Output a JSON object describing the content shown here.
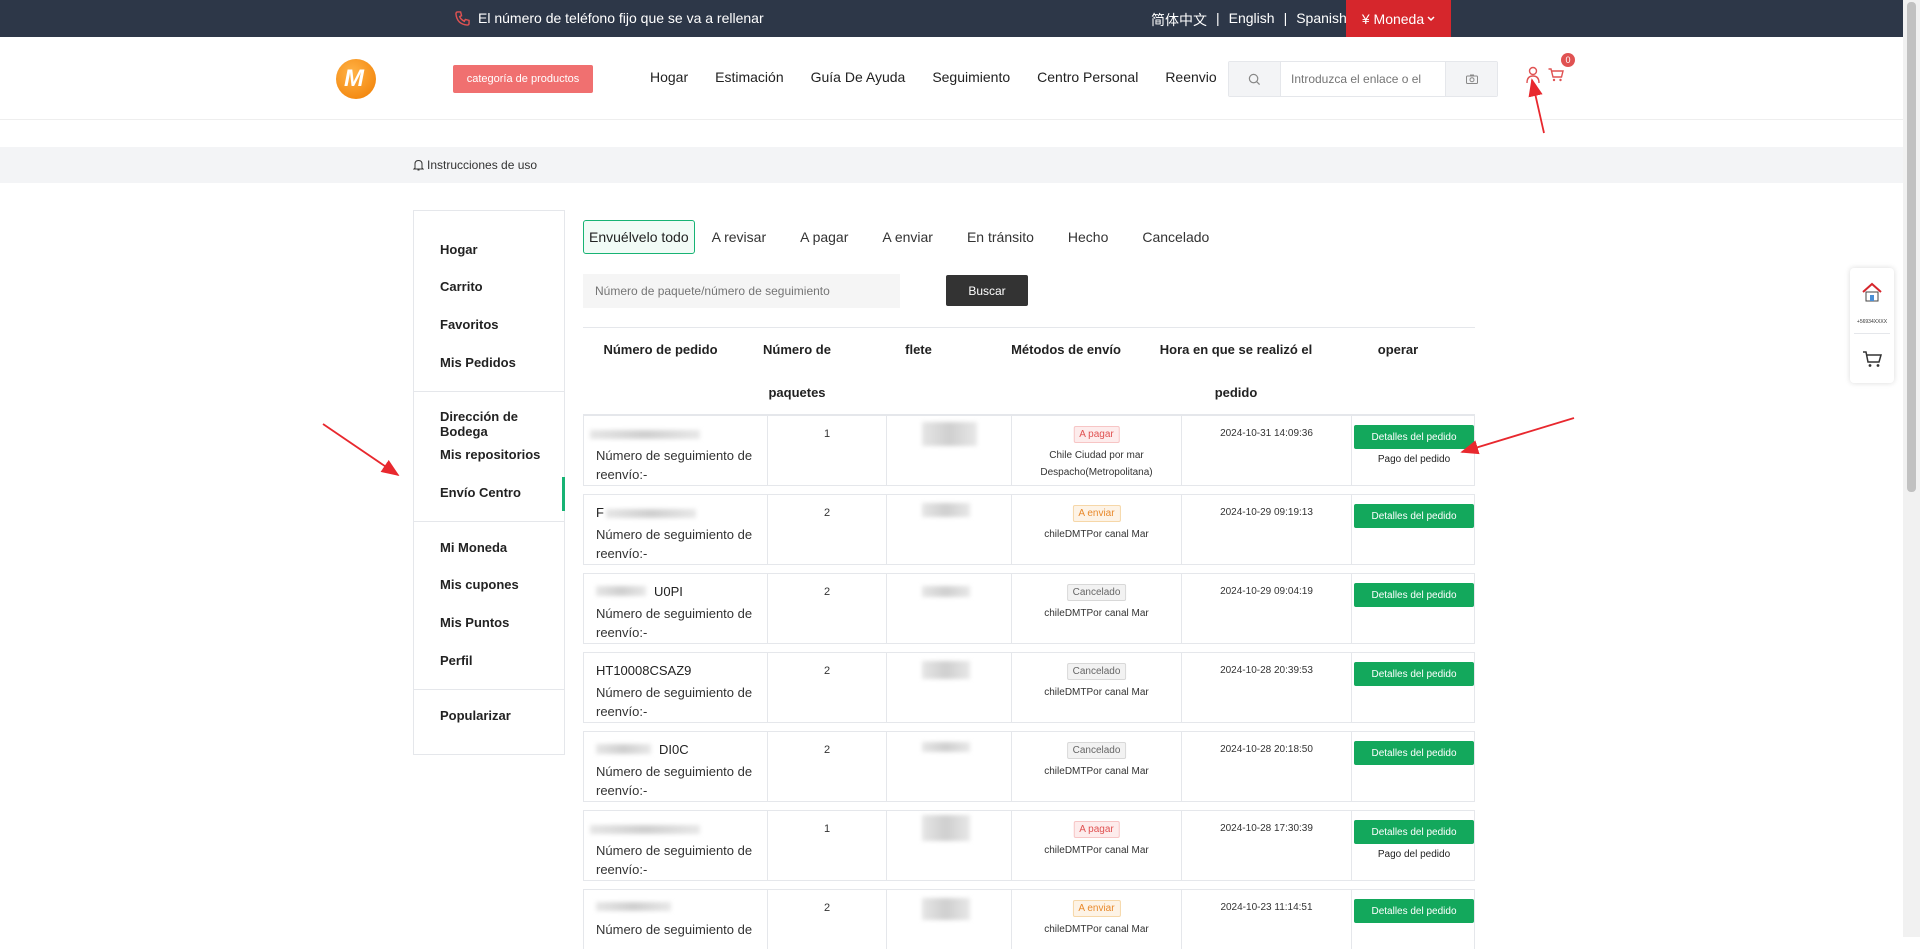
{
  "topbar": {
    "phone_text": "El número de teléfono fijo que se va a rellenar",
    "languages": [
      "简体中文",
      "English",
      "Spanish"
    ],
    "currency_label": "¥ Moneda"
  },
  "header": {
    "logo_letter": "M",
    "category_button": "categoría de productos",
    "nav": [
      "Hogar",
      "Estimación",
      "Guía De Ayuda",
      "Seguimiento",
      "Centro Personal",
      "Reenvio"
    ],
    "search_placeholder": "Introduzca el enlace o el",
    "cart_count": "0"
  },
  "notice": {
    "text": "Instrucciones de uso"
  },
  "sidebar": {
    "items": [
      "Hogar",
      "Carrito",
      "Favoritos",
      "Mis Pedidos",
      "Dirección de Bodega",
      "Mis repositorios",
      "Envío Centro",
      "Mi Moneda",
      "Mis cupones",
      "Mis Puntos",
      "Perfil",
      "Popularizar"
    ],
    "active": "Envío Centro"
  },
  "tabs": [
    "Envuélvelo todo",
    "A revisar",
    "A pagar",
    "A enviar",
    "En tránsito",
    "Hecho",
    "Cancelado"
  ],
  "filter": {
    "placeholder": "Número de paquete/número de seguimiento",
    "button": "Buscar"
  },
  "table": {
    "headers": [
      "Número de pedido",
      "Número de paquetes",
      "flete",
      "Métodos de envío",
      "Hora en que se realizó el pedido",
      "operar"
    ],
    "rows": [
      {
        "order_id": "",
        "tracking": "Número de seguimiento de reenvío:-",
        "packages": "1",
        "status": "A pagar",
        "method": "Chile Ciudad por mar Despacho(Metropolitana)",
        "time": "2024-10-31 14:09:36",
        "action": "Detalles del pedido",
        "pay": "Pago del pedido"
      },
      {
        "order_id": "F",
        "tracking": "Número de seguimiento de reenvío:-",
        "packages": "2",
        "status": "A enviar",
        "method": "chileDMTPor canal Mar",
        "time": "2024-10-29 09:19:13",
        "action": "Detalles del pedido",
        "pay": ""
      },
      {
        "order_id": "U0PI",
        "tracking": "Número de seguimiento de reenvío:-",
        "packages": "2",
        "status": "Cancelado",
        "method": "chileDMTPor canal Mar",
        "time": "2024-10-29 09:04:19",
        "action": "Detalles del pedido",
        "pay": ""
      },
      {
        "order_id": "HT10008CSAZ9",
        "tracking": "Número de seguimiento de reenvío:-",
        "packages": "2",
        "status": "Cancelado",
        "method": "chileDMTPor canal Mar",
        "time": "2024-10-28 20:39:53",
        "action": "Detalles del pedido",
        "pay": ""
      },
      {
        "order_id": "DI0C",
        "tracking": "Número de seguimiento de reenvío:-",
        "packages": "2",
        "status": "Cancelado",
        "method": "chileDMTPor canal Mar",
        "time": "2024-10-28 20:18:50",
        "action": "Detalles del pedido",
        "pay": ""
      },
      {
        "order_id": "",
        "tracking": "Número de seguimiento de reenvío:-",
        "packages": "1",
        "status": "A pagar",
        "method": "chileDMTPor canal Mar",
        "time": "2024-10-28 17:30:39",
        "action": "Detalles del pedido",
        "pay": "Pago del pedido"
      },
      {
        "order_id": "",
        "tracking": "Número de seguimiento de",
        "packages": "2",
        "status": "A enviar",
        "method": "chileDMTPor canal Mar",
        "time": "2024-10-23 11:14:51",
        "action": "Detalles del pedido",
        "pay": ""
      }
    ]
  },
  "float_panel": {
    "phone": "+56934XXXX"
  },
  "colors": {
    "accent_green": "#13a85c",
    "topbar": "#2d3748",
    "currency_red": "#d6262c"
  }
}
